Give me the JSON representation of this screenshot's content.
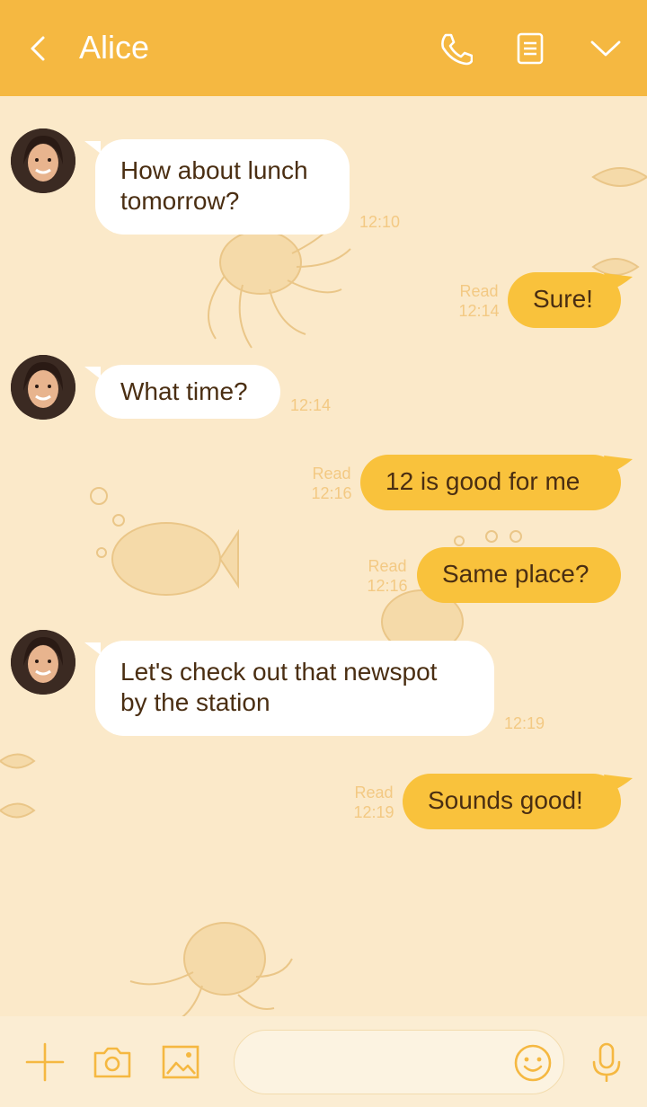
{
  "header": {
    "title": "Alice",
    "back_icon": "chevron-left-icon",
    "call_icon": "phone-icon",
    "notes_icon": "document-icon",
    "menu_icon": "chevron-down-icon"
  },
  "colors": {
    "header_bg": "#f5b841",
    "background": "#fbe9c9",
    "outgoing_bubble": "#f9c23c",
    "incoming_bubble": "#ffffff",
    "text": "#4a2e12",
    "meta_text": "#f3c983"
  },
  "messages": [
    {
      "direction": "incoming",
      "text": "How about lunch\ntomorrow?",
      "time": "12:10"
    },
    {
      "direction": "outgoing",
      "text": "Sure!",
      "read": "Read",
      "time": "12:14"
    },
    {
      "direction": "incoming",
      "text": "What time?",
      "time": "12:14"
    },
    {
      "direction": "outgoing",
      "text": "12 is good for me",
      "read": "Read",
      "time": "12:16"
    },
    {
      "direction": "outgoing",
      "text": "Same place?",
      "read": "Read",
      "time": "12:16"
    },
    {
      "direction": "incoming",
      "text": "Let's check out that newspot\nby the station",
      "time": "12:19"
    },
    {
      "direction": "outgoing",
      "text": "Sounds good!",
      "read": "Read",
      "time": "12:19"
    }
  ],
  "input": {
    "placeholder": "",
    "add_icon": "plus-icon",
    "camera_icon": "camera-icon",
    "image_icon": "image-icon",
    "emoji_icon": "smiley-icon",
    "mic_icon": "microphone-icon"
  }
}
